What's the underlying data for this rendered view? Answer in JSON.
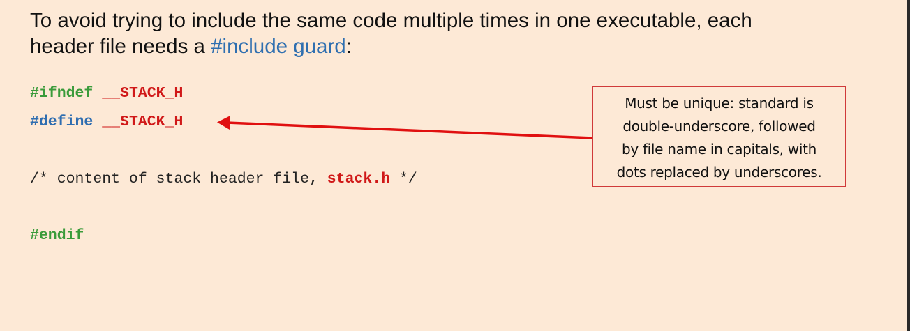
{
  "heading": {
    "line1": "To avoid trying to include the same code multiple times in one executable, each",
    "line2_prefix": "header file needs a ",
    "line2_link": "#include guard",
    "line2_suffix": ":"
  },
  "code": {
    "ifndef_kw": "#ifndef",
    "ifndef_macro": "__STACK_H",
    "define_kw": "#define",
    "define_macro": "__STACK_H",
    "comment_open": "/* content of stack header file, ",
    "filename": "stack.h",
    "comment_close": " */",
    "endif_kw": "#endif"
  },
  "callout": {
    "lines": [
      "Must be unique: standard is",
      "double-underscore, followed",
      "by file name in capitals, with",
      "dots replaced by underscores."
    ]
  },
  "colors": {
    "background": "#fde9d6",
    "accent_red": "#d01818",
    "accent_green": "#3a9b3a",
    "accent_blue": "#2e6db0",
    "link_blue": "#2f6fb0"
  }
}
